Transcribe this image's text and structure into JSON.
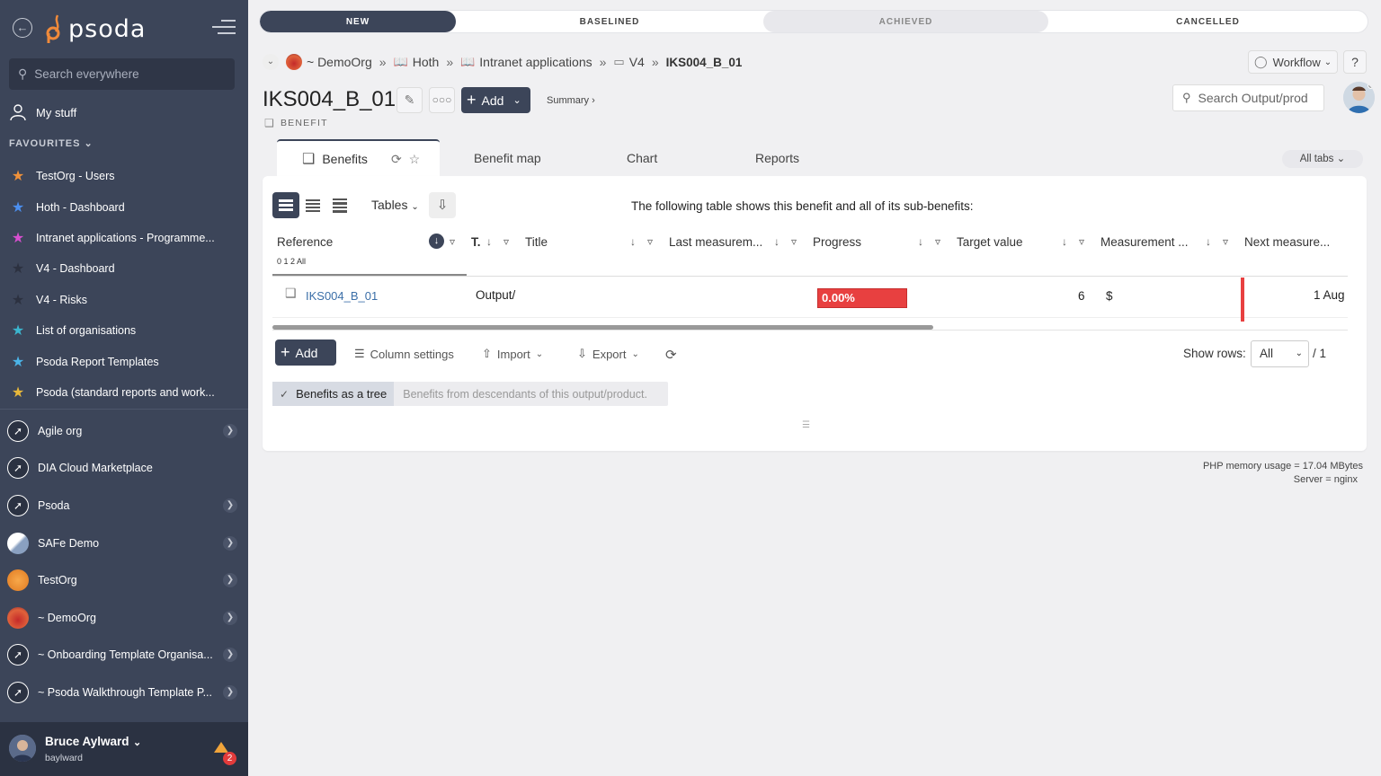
{
  "app": {
    "brand": "psoda"
  },
  "sidebar": {
    "search_placeholder": "Search everywhere",
    "my_stuff": "My stuff",
    "favourites_heading": "FAVOURITES",
    "favourites": [
      {
        "label": "TestOrg - Users",
        "color": "#f0913a"
      },
      {
        "label": "Hoth - Dashboard",
        "color": "#4b8ff0"
      },
      {
        "label": "Intranet applications - Programme...",
        "color": "#d84fd0"
      },
      {
        "label": "V4 - Dashboard",
        "color": "#2c3140"
      },
      {
        "label": "V4 - Risks",
        "color": "#2c3140"
      },
      {
        "label": "List of organisations",
        "color": "#3bb6cf"
      },
      {
        "label": "Psoda Report Templates",
        "color": "#4bb4e8"
      },
      {
        "label": "Psoda (standard reports and work...",
        "color": "#e8b83a"
      }
    ],
    "orgs": [
      {
        "label": "Agile org",
        "icon": "compass-icon",
        "has_chevron": true
      },
      {
        "label": "DIA Cloud Marketplace",
        "icon": "compass-icon",
        "has_chevron": false
      },
      {
        "label": "Psoda",
        "icon": "compass-icon",
        "has_chevron": true
      },
      {
        "label": "SAFe Demo",
        "icon": "safe-logo-icon",
        "has_chevron": true
      },
      {
        "label": "TestOrg",
        "icon": "orange-circle-icon",
        "has_chevron": true
      },
      {
        "label": "~ DemoOrg",
        "icon": "sunset-icon",
        "has_chevron": true
      },
      {
        "label": "~ Onboarding Template Organisa...",
        "icon": "compass-icon",
        "has_chevron": true
      },
      {
        "label": "~ Psoda Walkthrough Template P...",
        "icon": "compass-icon",
        "has_chevron": true
      }
    ],
    "user": {
      "name": "Bruce Aylward",
      "login": "baylward",
      "notifications": "2"
    }
  },
  "stages": [
    "NEW",
    "BASELINED",
    "ACHIEVED",
    "CANCELLED"
  ],
  "breadcrumb": {
    "org": "~ DemoOrg",
    "items": [
      "Hoth",
      "Intranet applications",
      "V4"
    ],
    "current": "IKS004_B_01"
  },
  "header": {
    "workflow_label": "Workflow",
    "help_label": "?",
    "title": "IKS004_B_01",
    "add_label": "Add",
    "summary_label": "Summary ›",
    "subtype": "BENEFIT",
    "search_placeholder": "Search Output/prod"
  },
  "tabs": {
    "items": [
      "Benefits",
      "Benefit map",
      "Chart",
      "Reports"
    ],
    "active": "Benefits",
    "all_tabs": "All tabs"
  },
  "table": {
    "tables_label": "Tables",
    "description": "The following table shows this benefit and all of its sub-benefits:",
    "levels": "0 1 2 All",
    "columns": [
      "Reference",
      "T.",
      "Title",
      "Last measurem...",
      "Progress",
      "Target value",
      "Measurement ...",
      "Next measure..."
    ],
    "rows": [
      {
        "reference": "IKS004_B_01",
        "title": "Output/",
        "progress": "0.00%",
        "target": "6",
        "measurement": "$",
        "next": "1 Aug"
      }
    ],
    "add_label": "Add",
    "column_settings": "Column settings",
    "import": "Import",
    "export": "Export",
    "show_rows_label": "Show rows:",
    "show_rows_value": "All",
    "page_of": "/ 1",
    "tree_on": "Benefits as a tree",
    "tree_off": "Benefits from descendants of this output/product."
  },
  "footer": {
    "memory": "PHP memory usage = 17.04 MBytes",
    "server": "Server = nginx"
  }
}
